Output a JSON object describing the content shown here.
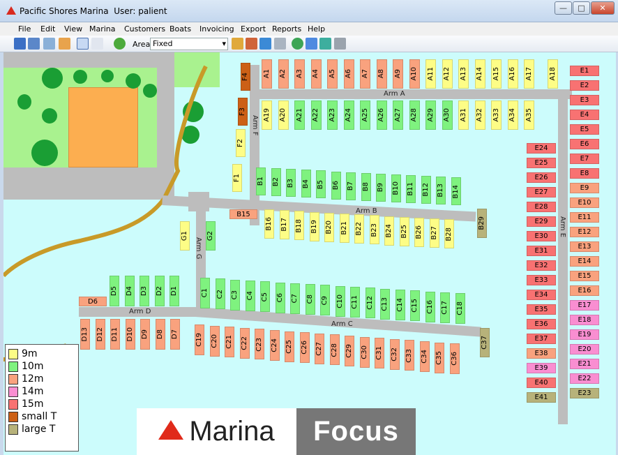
{
  "window": {
    "app": "Pacific Shores Marina",
    "user_label": "User: palient",
    "min": "—",
    "max": "□",
    "close": "✕"
  },
  "menu": [
    "File",
    "Edit",
    "View",
    "Marina",
    "Customers",
    "Boats",
    "Invoicing",
    "Export",
    "Reports",
    "Help"
  ],
  "toolbar": {
    "area_label": "Area",
    "area_value": "Fixed"
  },
  "colors": {
    "9m": "#fdfd86",
    "10m": "#7ff27f",
    "12m": "#f9a27e",
    "14m": "#f98ed1",
    "15m": "#f87272",
    "small T": "#cc6016",
    "large T": "#b7b27a"
  },
  "legend": [
    {
      "label": "9m",
      "cls": "b-9"
    },
    {
      "label": "10m",
      "cls": "b-10"
    },
    {
      "label": "12m",
      "cls": "b-12"
    },
    {
      "label": "14m",
      "cls": "b-14"
    },
    {
      "label": "15m",
      "cls": "b-15"
    },
    {
      "label": "small T",
      "cls": "b-st"
    },
    {
      "label": "large T",
      "cls": "b-lt"
    }
  ],
  "arms": {
    "A": "Arm A",
    "B": "Arm B",
    "C": "Arm C",
    "D": "Arm D",
    "E": "Arm E",
    "F": "Arm F",
    "G": "Arm G"
  },
  "berths": {
    "A_top": [
      [
        "A1",
        "12"
      ],
      [
        "A2",
        "12"
      ],
      [
        "A3",
        "12"
      ],
      [
        "A4",
        "12"
      ],
      [
        "A5",
        "12"
      ],
      [
        "A6",
        "12"
      ],
      [
        "A7",
        "12"
      ],
      [
        "A8",
        "12"
      ],
      [
        "A9",
        "12"
      ],
      [
        "A10",
        "12"
      ],
      [
        "A11",
        "9"
      ],
      [
        "A12",
        "9"
      ],
      [
        "A13",
        "9"
      ],
      [
        "A14",
        "9"
      ],
      [
        "A15",
        "9"
      ],
      [
        "A16",
        "9"
      ],
      [
        "A17",
        "9"
      ]
    ],
    "A18": "A18",
    "A_bot": [
      [
        "A19",
        "9"
      ],
      [
        "A20",
        "9"
      ],
      [
        "A21",
        "10"
      ],
      [
        "A22",
        "10"
      ],
      [
        "A23",
        "10"
      ],
      [
        "A24",
        "10"
      ],
      [
        "A25",
        "10"
      ],
      [
        "A26",
        "10"
      ],
      [
        "A27",
        "10"
      ],
      [
        "A28",
        "10"
      ],
      [
        "A29",
        "10"
      ],
      [
        "A30",
        "10"
      ],
      [
        "A31",
        "9"
      ],
      [
        "A32",
        "9"
      ],
      [
        "A33",
        "9"
      ],
      [
        "A34",
        "9"
      ],
      [
        "A35",
        "9"
      ]
    ],
    "F": [
      [
        "F4",
        "st"
      ],
      [
        "F3",
        "st"
      ],
      [
        "F2",
        "9"
      ],
      [
        "F1",
        "9"
      ]
    ],
    "B_top": [
      [
        "B1",
        "10"
      ],
      [
        "B2",
        "10"
      ],
      [
        "B3",
        "10"
      ],
      [
        "B4",
        "10"
      ],
      [
        "B5",
        "10"
      ],
      [
        "B6",
        "10"
      ],
      [
        "B7",
        "10"
      ],
      [
        "B8",
        "10"
      ],
      [
        "B9",
        "10"
      ],
      [
        "B10",
        "10"
      ],
      [
        "B11",
        "10"
      ],
      [
        "B12",
        "10"
      ],
      [
        "B13",
        "10"
      ],
      [
        "B14",
        "10"
      ]
    ],
    "B_bot": [
      [
        "B16",
        "9"
      ],
      [
        "B17",
        "9"
      ],
      [
        "B18",
        "9"
      ],
      [
        "B19",
        "9"
      ],
      [
        "B20",
        "9"
      ],
      [
        "B21",
        "9"
      ],
      [
        "B22",
        "9"
      ],
      [
        "B23",
        "9"
      ],
      [
        "B24",
        "9"
      ],
      [
        "B25",
        "9"
      ],
      [
        "B26",
        "9"
      ],
      [
        "B27",
        "9"
      ],
      [
        "B28",
        "9"
      ]
    ],
    "B15": "B15",
    "B29": "B29",
    "G": [
      [
        "G1",
        "9"
      ],
      [
        "G2",
        "10"
      ]
    ],
    "D_top": [
      [
        "D5",
        "10"
      ],
      [
        "D4",
        "10"
      ],
      [
        "D3",
        "10"
      ],
      [
        "D2",
        "10"
      ],
      [
        "D1",
        "10"
      ]
    ],
    "D6": "D6",
    "D_bot": [
      [
        "D13",
        "12"
      ],
      [
        "D12",
        "12"
      ],
      [
        "D11",
        "12"
      ],
      [
        "D10",
        "12"
      ],
      [
        "D9",
        "12"
      ],
      [
        "D8",
        "12"
      ],
      [
        "D7",
        "12"
      ]
    ],
    "C_top": [
      [
        "C1",
        "10"
      ],
      [
        "C2",
        "10"
      ],
      [
        "C3",
        "10"
      ],
      [
        "C4",
        "10"
      ],
      [
        "C5",
        "10"
      ],
      [
        "C6",
        "10"
      ],
      [
        "C7",
        "10"
      ],
      [
        "C8",
        "10"
      ],
      [
        "C9",
        "10"
      ],
      [
        "C10",
        "10"
      ],
      [
        "C11",
        "10"
      ],
      [
        "C12",
        "10"
      ],
      [
        "C13",
        "10"
      ],
      [
        "C14",
        "10"
      ],
      [
        "C15",
        "10"
      ],
      [
        "C16",
        "10"
      ],
      [
        "C17",
        "10"
      ],
      [
        "C18",
        "10"
      ]
    ],
    "C_bot": [
      [
        "C19",
        "12"
      ],
      [
        "C20",
        "12"
      ],
      [
        "C21",
        "12"
      ],
      [
        "C22",
        "12"
      ],
      [
        "C23",
        "12"
      ],
      [
        "C24",
        "12"
      ],
      [
        "C25",
        "12"
      ],
      [
        "C26",
        "12"
      ],
      [
        "C27",
        "12"
      ],
      [
        "C28",
        "12"
      ],
      [
        "C29",
        "12"
      ],
      [
        "C30",
        "12"
      ],
      [
        "C31",
        "12"
      ],
      [
        "C32",
        "12"
      ],
      [
        "C33",
        "12"
      ],
      [
        "C34",
        "12"
      ],
      [
        "C35",
        "12"
      ],
      [
        "C36",
        "12"
      ]
    ],
    "C37": "C37",
    "E_right": [
      [
        "E1",
        "15"
      ],
      [
        "E2",
        "15"
      ],
      [
        "E3",
        "15"
      ],
      [
        "E4",
        "15"
      ],
      [
        "E5",
        "15"
      ],
      [
        "E6",
        "15"
      ],
      [
        "E7",
        "15"
      ],
      [
        "E8",
        "15"
      ],
      [
        "E9",
        "12"
      ],
      [
        "E10",
        "12"
      ],
      [
        "E11",
        "12"
      ],
      [
        "E12",
        "12"
      ],
      [
        "E13",
        "12"
      ],
      [
        "E14",
        "12"
      ],
      [
        "E15",
        "12"
      ],
      [
        "E16",
        "12"
      ],
      [
        "E17",
        "14"
      ],
      [
        "E18",
        "14"
      ],
      [
        "E19",
        "14"
      ],
      [
        "E20",
        "14"
      ],
      [
        "E21",
        "14"
      ],
      [
        "E22",
        "14"
      ],
      [
        "E23",
        "lt"
      ]
    ],
    "E_left": [
      [
        "E24",
        "15"
      ],
      [
        "E25",
        "15"
      ],
      [
        "E26",
        "15"
      ],
      [
        "E27",
        "15"
      ],
      [
        "E28",
        "15"
      ],
      [
        "E29",
        "15"
      ],
      [
        "E30",
        "15"
      ],
      [
        "E31",
        "15"
      ],
      [
        "E32",
        "15"
      ],
      [
        "E33",
        "15"
      ],
      [
        "E34",
        "15"
      ],
      [
        "E35",
        "15"
      ],
      [
        "E36",
        "15"
      ],
      [
        "E37",
        "15"
      ],
      [
        "E38",
        "12"
      ],
      [
        "E39",
        "14"
      ],
      [
        "E40",
        "15"
      ],
      [
        "E41",
        "lt"
      ]
    ]
  },
  "logo": {
    "left": "Marina",
    "right": "Focus"
  }
}
